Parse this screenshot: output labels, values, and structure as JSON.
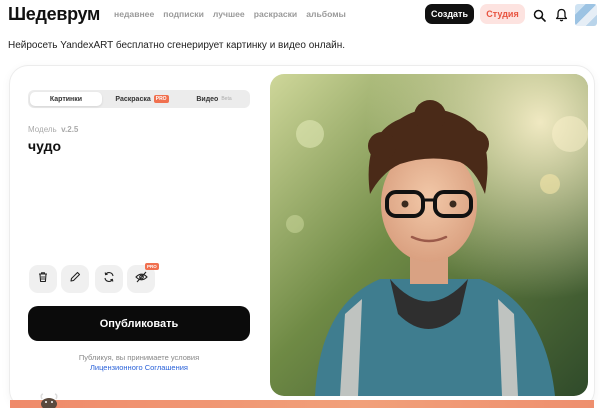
{
  "header": {
    "logo": "Шедеврум",
    "nav": [
      "недавнее",
      "подписки",
      "лучшее",
      "раскраски",
      "альбомы"
    ],
    "create_label": "Создать",
    "studio_label": "Студия"
  },
  "subtitle": "Нейросеть YandexART бесплатно сгенерирует картинку и видео онлайн.",
  "editor": {
    "tabs": {
      "images": "Картинки",
      "coloring": "Раскраска",
      "coloring_badge": "PRO",
      "video": "Видео",
      "video_badge": "Beta"
    },
    "model_label": "Модель",
    "model_version": "v.2.5",
    "prompt": "чудо",
    "tool_badge": "PRO",
    "publish_label": "Опубликовать",
    "terms_text": "Публикуя, вы принимаете условия",
    "terms_link": "Лицензионного Соглашения"
  },
  "icons": [
    "search-icon",
    "bell-icon",
    "trash-icon",
    "pencil-icon",
    "refresh-icon",
    "eye-off-icon"
  ],
  "colors": {
    "accent": "#f0704f",
    "studio_bg": "#fde3e0",
    "studio_text": "#e8533f",
    "primary_button": "#0b0b0b",
    "link": "#2a62d9"
  }
}
